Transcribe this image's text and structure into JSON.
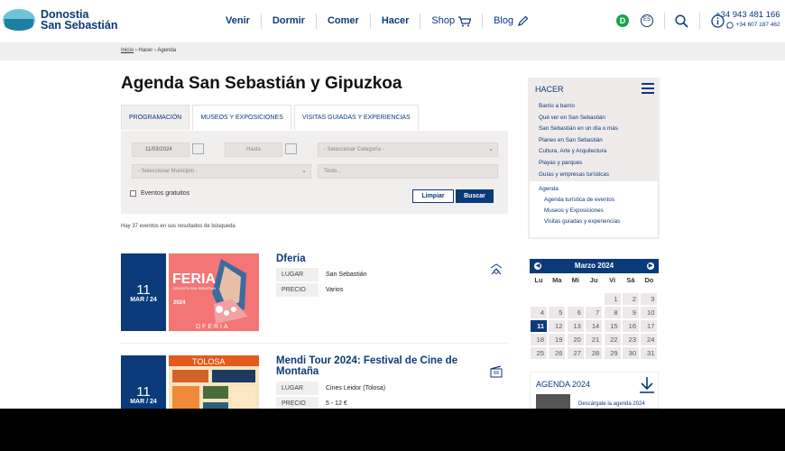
{
  "header": {
    "logo_line1": "Donostia",
    "logo_line2": "San Sebastián",
    "nav": [
      "Venir",
      "Dormir",
      "Comer",
      "Hacer",
      "Shop",
      "Blog"
    ],
    "lang_badge": "D",
    "lang_code": "ES",
    "phone_main": "+34 943 481 166",
    "phone_whatsapp": "+34 607 187 462"
  },
  "breadcrumb": [
    "Inicio",
    "Hacer",
    "Agenda"
  ],
  "main": {
    "title": "Agenda San Sebastián y Gipuzkoa",
    "tabs": [
      "PROGRAMACIÓN",
      "MUSEOS Y EXPOSICIONES",
      "VISITAS GUIADAS Y EXPERIENCIAS"
    ],
    "filters": {
      "date_from": "11/03/2024",
      "date_to_placeholder": "Hasta",
      "category_placeholder": "- Seleccionar Categoría -",
      "municipio_placeholder": "- Seleccionar Municipio -",
      "text_placeholder": "Texto...",
      "free_events_label": "Eventos gratuitos",
      "clear_label": "Limpiar",
      "search_label": "Buscar"
    },
    "results_text": "Hay 37 eventos en sus resultados de búsqueda",
    "events": [
      {
        "day": "11",
        "month": "MAR / 24",
        "title": "Dferia",
        "rows": [
          {
            "label": "LUGAR",
            "value": "San Sebastián"
          },
          {
            "label": "PRECIO",
            "value": "Varios"
          }
        ],
        "icon": "fair-icon",
        "thumb_text": "FERIA",
        "thumb_sub": "DONOSTIA SAN SEBASTIAN",
        "thumb_year": "2024",
        "thumb_bottom": "DFERIA",
        "colors": {
          "bg": "#f26a6a",
          "accent": "#f4a8a8"
        }
      },
      {
        "day": "11",
        "month": "MAR / 24",
        "title": "Mendi Tour 2024: Festival de Cine de Montaña",
        "rows": [
          {
            "label": "LUGAR",
            "value": "Cines Leidor (Tolosa)"
          },
          {
            "label": "PRECIO",
            "value": "5 - 12 €"
          }
        ],
        "icon": "cinema-icon",
        "thumb_text": "TOLOSA",
        "colors": {
          "bg": "#f3d9a8",
          "accent": "#e45a1d"
        }
      }
    ]
  },
  "sidebar": {
    "title": "HACER",
    "links": [
      "Barrio a barrio",
      "Qué ver en San Sebastián",
      "San Sebastián en un día o más",
      "Planes en San Sebastián",
      "Cultura, Arte y Arquitectura",
      "Playas y parques",
      "Guías y empresas turísticas"
    ],
    "current": "Agenda",
    "sublinks": [
      "Agenda turística de eventos",
      "Museos y Exposiciones",
      "Visitas guiadas y experiencias"
    ],
    "calendar": {
      "month_label": "Marzo 2024",
      "weekdays": [
        "Lu",
        "Ma",
        "Mi",
        "Ju",
        "Vi",
        "Sá",
        "Do"
      ],
      "selected_day": "11",
      "days": [
        "1",
        "2",
        "3",
        "4",
        "5",
        "6",
        "7",
        "8",
        "9",
        "10",
        "11",
        "12",
        "13",
        "14",
        "15",
        "16",
        "17",
        "18",
        "19",
        "20",
        "21",
        "22",
        "23",
        "24",
        "25",
        "26",
        "27",
        "28",
        "29",
        "30",
        "31"
      ]
    },
    "agenda_box": {
      "title": "AGENDA 2024",
      "download_text": "Descárgate la agenda 2024"
    }
  },
  "colors": {
    "brand": "#0b3a7a",
    "band": "#f1eeee",
    "whatsapp": "#0b3a7a",
    "lang": "#16a34a"
  }
}
